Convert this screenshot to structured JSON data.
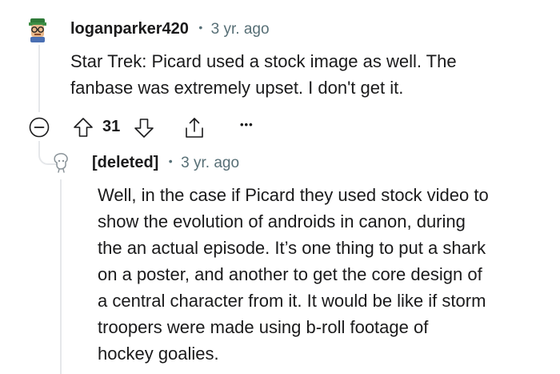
{
  "comment": {
    "author": "loganparker420",
    "separator": "•",
    "time": "3 yr. ago",
    "body_lines": [
      "Star Trek: Picard used a stock image as well. The",
      "fanbase was extremely upset. I don't get it."
    ],
    "score": "31",
    "more": "•••"
  },
  "reply": {
    "author": "[deleted]",
    "separator": "•",
    "time": "3 yr. ago",
    "body_lines": [
      "Well, in the case if Picard they used stock video to",
      "show the evolution of androids in canon, during",
      "the an actual episode. It’s one thing to put a shark",
      "on a poster, and another to get the core design of",
      "a central character from it. It would be like if storm",
      "troopers were made using b-roll footage of",
      "hockey goalies."
    ]
  },
  "colors": {
    "text": "#1a1a1b",
    "meta": "#576f76",
    "thread": "#e5e7ea"
  },
  "icons": [
    "avatar",
    "collapse-icon",
    "upvote-icon",
    "downvote-icon",
    "share-icon",
    "more-icon",
    "deleted-avatar-icon"
  ]
}
